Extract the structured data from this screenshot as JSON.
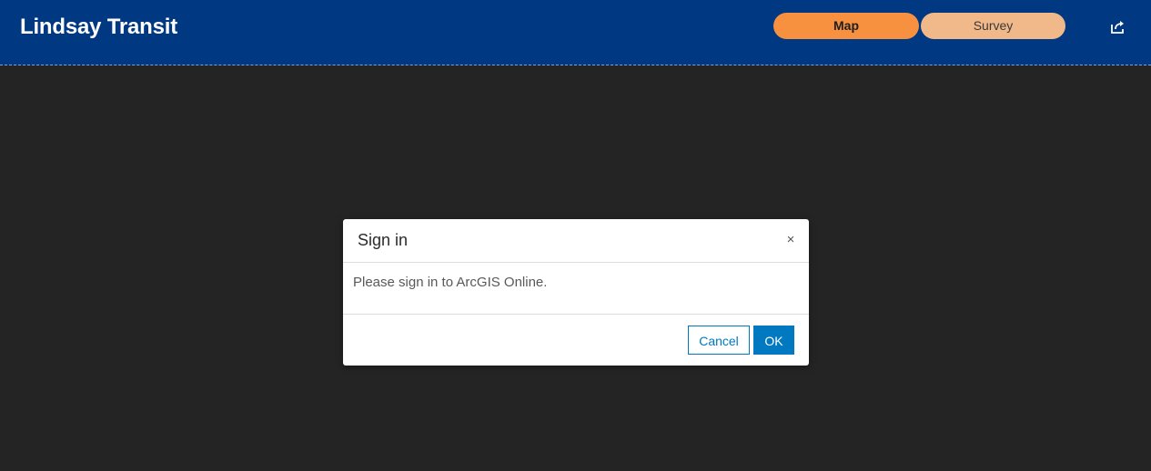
{
  "header": {
    "title": "Lindsay Transit",
    "nav": [
      {
        "label": "Map",
        "active": true
      },
      {
        "label": "Survey",
        "active": false
      }
    ],
    "share_icon": "share-icon"
  },
  "dialog": {
    "title": "Sign in",
    "close_glyph": "×",
    "message": "Please sign in to ArcGIS Online.",
    "cancel_label": "Cancel",
    "ok_label": "OK"
  },
  "colors": {
    "header_bg": "#003882",
    "map_bg": "#242424",
    "nav_active": "#f7913f",
    "nav_inactive": "#f1b98a",
    "primary": "#0079c1"
  }
}
